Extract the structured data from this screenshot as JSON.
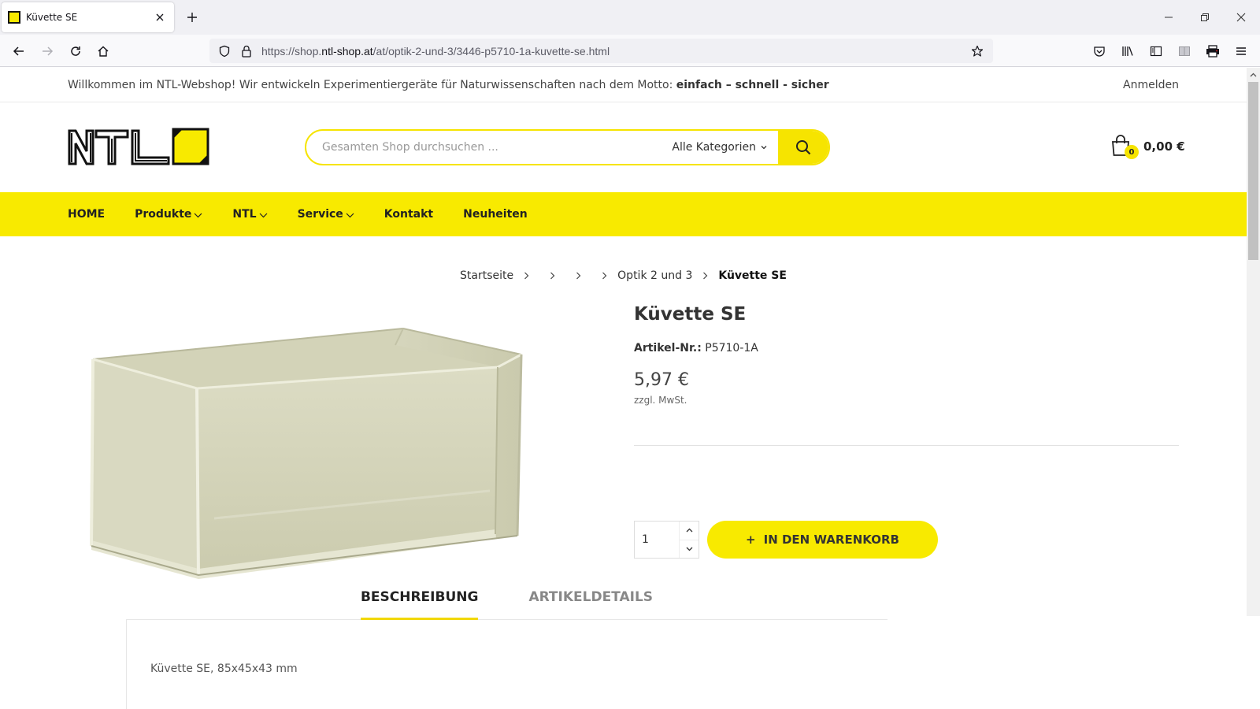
{
  "browser": {
    "tab_title": "Küvette SE",
    "url_prefix": "https://shop.",
    "url_domain": "ntl-shop.at",
    "url_path": "/at/optik-2-und-3/3446-p5710-1a-kuvette-se.html"
  },
  "topbar": {
    "welcome_text": "Willkommen im NTL-Webshop! Wir entwickeln Experimentiergeräte für Naturwissenschaften nach dem Motto: ",
    "motto": "einfach – schnell - sicher",
    "login": "Anmelden"
  },
  "header": {
    "logo_text": "NTL",
    "search_placeholder": "Gesamten Shop durchsuchen ...",
    "category_select": "Alle Kategorien",
    "cart_count": "0",
    "cart_total": "0,00 €"
  },
  "nav": {
    "home": "HOME",
    "produkte": "Produkte",
    "ntl": "NTL",
    "service": "Service",
    "kontakt": "Kontakt",
    "neuheiten": "Neuheiten"
  },
  "breadcrumb": {
    "home": "Startseite",
    "category": "Optik 2 und 3",
    "current": "Küvette SE"
  },
  "product": {
    "title": "Küvette SE",
    "sku_label": "Artikel-Nr.:",
    "sku_value": "P5710-1A",
    "price": "5,97 €",
    "tax_note": "zzgl. MwSt.",
    "quantity": "1",
    "add_to_cart": "IN DEN WARENKORB",
    "add_icon": "+"
  },
  "tabs": {
    "description": "BESCHREIBUNG",
    "details": "ARTIKELDETAILS",
    "description_text": "Küvette SE, 85x45x43 mm"
  },
  "colors": {
    "brand_yellow": "#f8ea00",
    "text_dark": "#222222"
  }
}
